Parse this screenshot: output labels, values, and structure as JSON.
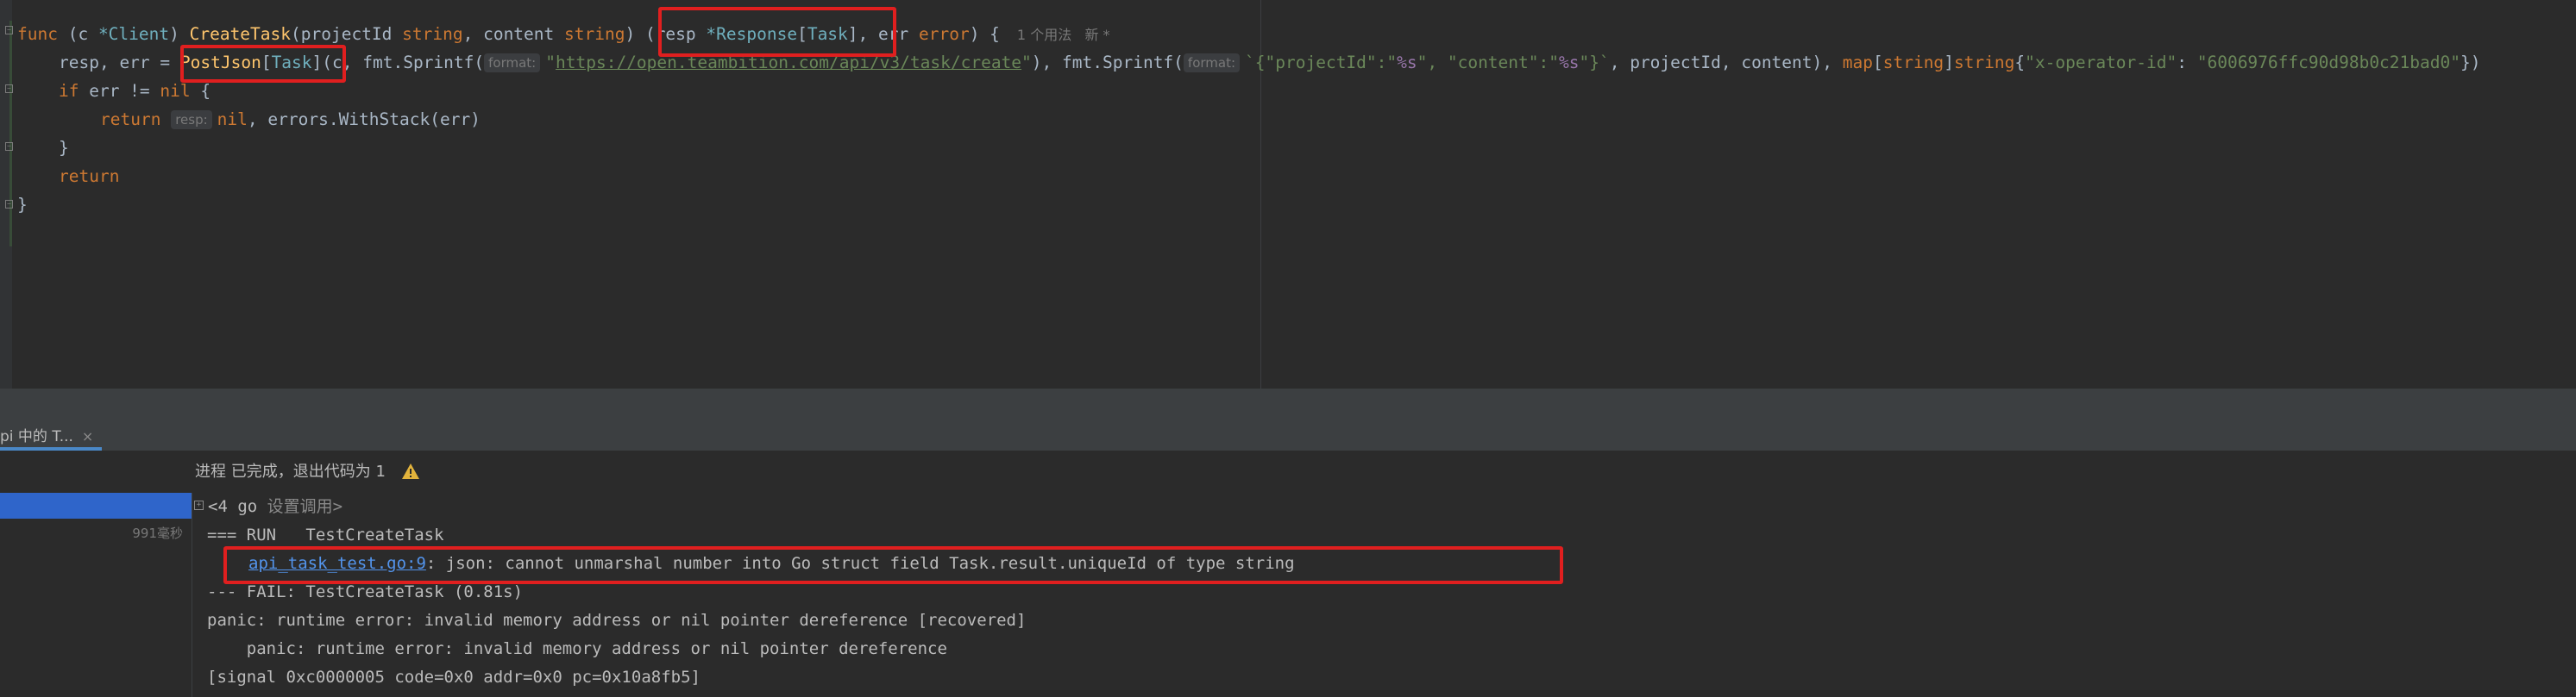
{
  "editor": {
    "line1": {
      "func_kw": "func",
      "receiver_open": " (c ",
      "receiver_type": "*Client",
      "receiver_close": ") ",
      "fn_name": "CreateTask",
      "params_open": "(projectId ",
      "t_string1": "string",
      "params_mid": ", content ",
      "t_string2": "string",
      "params_close": ") ",
      "ret_open": "(resp ",
      "ret_type": "*Response",
      "ret_bracket_open": "[",
      "ret_generic": "Task",
      "ret_bracket_close": "], err ",
      "ret_err_type": "error",
      "ret_close": ") {",
      "usage_hint": "1 个用法   新 *"
    },
    "line2": {
      "lhs": "resp, err = ",
      "call_fn": "PostJson",
      "bracket_open": "[",
      "generic": "Task",
      "bracket_close": "](",
      "arg_c": "c, ",
      "sprintf1": "fmt.Sprintf(",
      "hint1": "format:",
      "quote_open": "\"",
      "url": "https://open.teambition.com/api/v3/task/create",
      "quote_close": "\"",
      "after_url": "), ",
      "sprintf2": "fmt.Sprintf(",
      "hint2": "format:",
      "json_a": "`{\"projectId\":\"",
      "fmt_a": "%s",
      "json_b": "\", \"content\":\"",
      "fmt_b": "%s",
      "json_c": "\"}`",
      "after_json": ", projectId, content), ",
      "map_kw": "map",
      "map_open": "[",
      "map_key": "string",
      "map_close": "]",
      "map_val": "string",
      "brace_open": "{",
      "header_key": "\"x-operator-id\"",
      "colon": ": ",
      "header_val": "\"6006976ffc90d98b0c21bad0\"",
      "end": "})"
    },
    "line3": {
      "if_kw": "if",
      "cond": " err != ",
      "nil_kw": "nil",
      "brace": " {"
    },
    "line4": {
      "return_kw": "return",
      "hint": "resp:",
      "nil_kw": "nil",
      "rest": ", errors.WithStack(err)"
    },
    "line5": {
      "brace": "}"
    },
    "line6": {
      "return_kw": "return"
    },
    "line7": {
      "brace": "}"
    }
  },
  "run_panel": {
    "tab_label": "pi 中的 T...",
    "tab_close": "×",
    "status_text": "进程 已完成，退出代码为 1",
    "tree_time": "991毫秒",
    "console": {
      "fold_marker": "+",
      "line1_prefix": "<4 go ",
      "line1_dim": "设置调用>",
      "line2": "=== RUN   TestCreateTask",
      "line3_link": "api_task_test.go:9",
      "line3_rest": ": json: cannot unmarshal number into Go struct field Task.result.uniqueId of type string",
      "line4": "--- FAIL: TestCreateTask (0.81s)",
      "line5": "panic: runtime error: invalid memory address or nil pointer dereference [recovered]",
      "line6": "    panic: runtime error: invalid memory address or nil pointer dereference",
      "line7": "[signal 0xc0000005 code=0x0 addr=0x0 pc=0x10a8fb5]"
    }
  },
  "colors": {
    "editor_bg": "#2b2b2b",
    "keyword": "#cc7832",
    "function": "#ffc66d",
    "type": "#6fafbd",
    "string": "#6a8759",
    "highlight_box": "#e01f1f",
    "link": "#5394ec",
    "selection": "#2f65ca"
  },
  "icons": [
    "fold-icon",
    "warning-icon",
    "close-icon"
  ]
}
